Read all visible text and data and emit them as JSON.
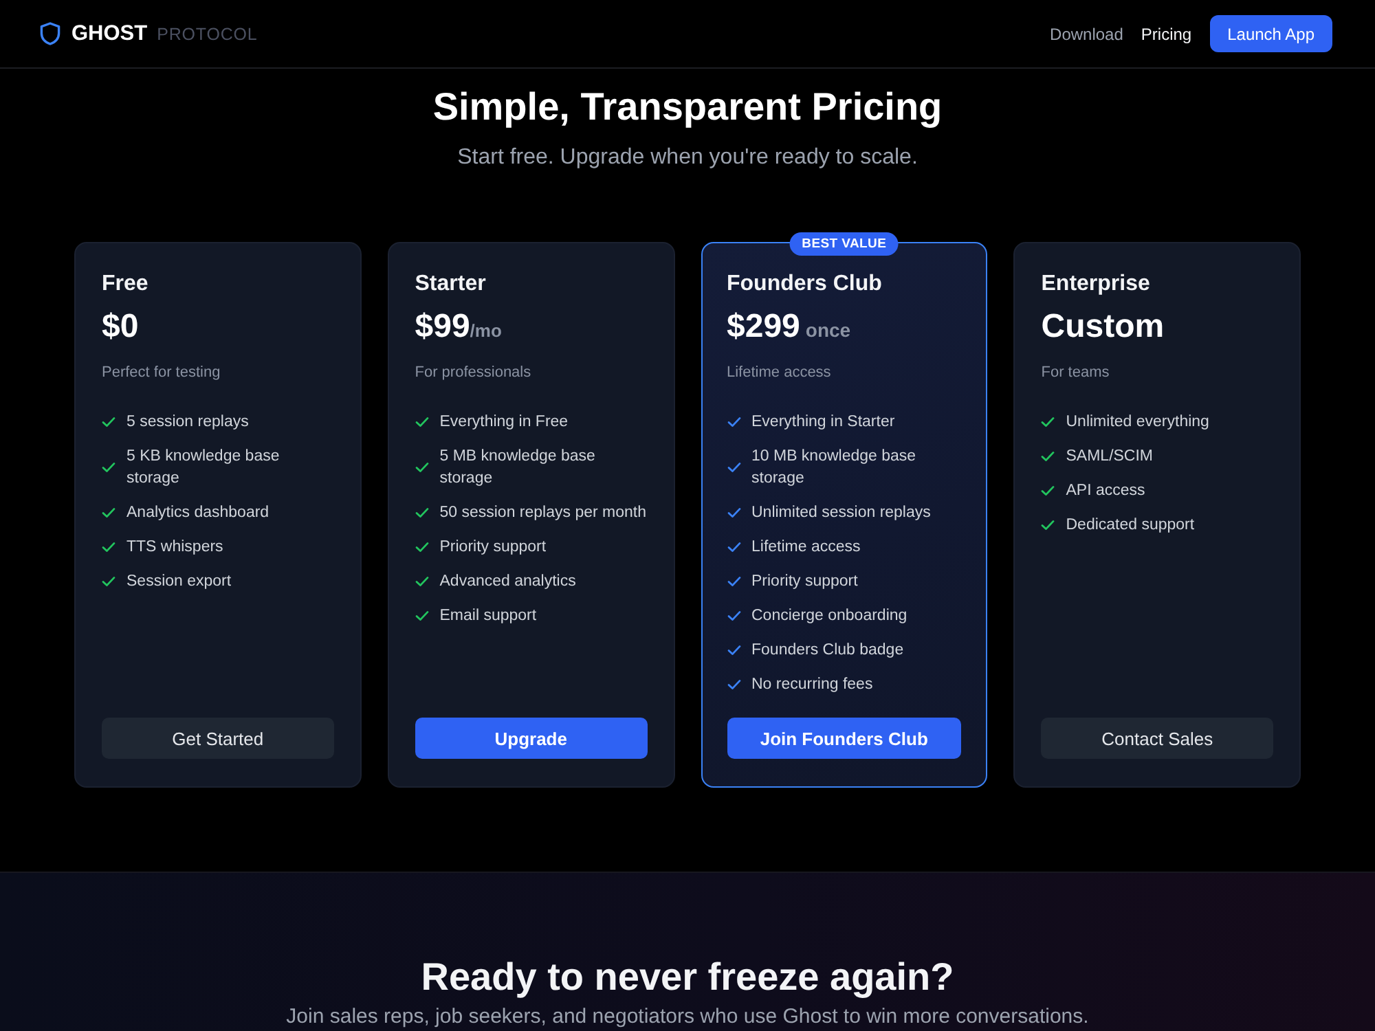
{
  "nav": {
    "logo": {
      "name": "GHOST",
      "suffix": "PROTOCOL"
    },
    "links": [
      {
        "label": "Download",
        "selected": false
      },
      {
        "label": "Pricing",
        "selected": true
      }
    ],
    "cta": "Launch App"
  },
  "hero": {
    "title": "Simple, Transparent Pricing",
    "subtitle": "Start free. Upgrade when you're ready to scale."
  },
  "plans": [
    {
      "name": "Free",
      "price": "$0",
      "tagline": "Perfect for testing",
      "featured": false,
      "features": [
        "5 session replays",
        "5 KB knowledge base storage",
        "Analytics dashboard",
        "TTS whispers",
        "Session export"
      ],
      "button": {
        "label": "Get Started",
        "kind": "secondary"
      }
    },
    {
      "name": "Starter",
      "price": "$99",
      "period": "/mo",
      "tagline": "For professionals",
      "featured": false,
      "features": [
        "Everything in Free",
        "5 MB knowledge base storage",
        "50 session replays per month",
        "Priority support",
        "Advanced analytics",
        "Email support"
      ],
      "button": {
        "label": "Upgrade",
        "kind": "primary"
      }
    },
    {
      "name": "Founders Club",
      "price": "$299",
      "period": "once",
      "badge": "BEST VALUE",
      "tagline": "Lifetime access",
      "featured": true,
      "features": [
        "Everything in Starter",
        "10 MB knowledge base storage",
        "Unlimited session replays",
        "Lifetime access",
        "Priority support",
        "Concierge onboarding",
        "Founders Club badge",
        "No recurring fees"
      ],
      "button": {
        "label": "Join Founders Club",
        "kind": "primary"
      }
    },
    {
      "name": "Enterprise",
      "price": "Custom",
      "tagline": "For teams",
      "featured": false,
      "features": [
        "Unlimited everything",
        "SAML/SCIM",
        "API access",
        "Dedicated support"
      ],
      "button": {
        "label": "Contact Sales",
        "kind": "secondary"
      }
    }
  ],
  "cta_section": {
    "title": "Ready to never freeze again?",
    "subtitle": "Join sales reps, job seekers, and negotiators who use Ghost to win more conversations."
  }
}
